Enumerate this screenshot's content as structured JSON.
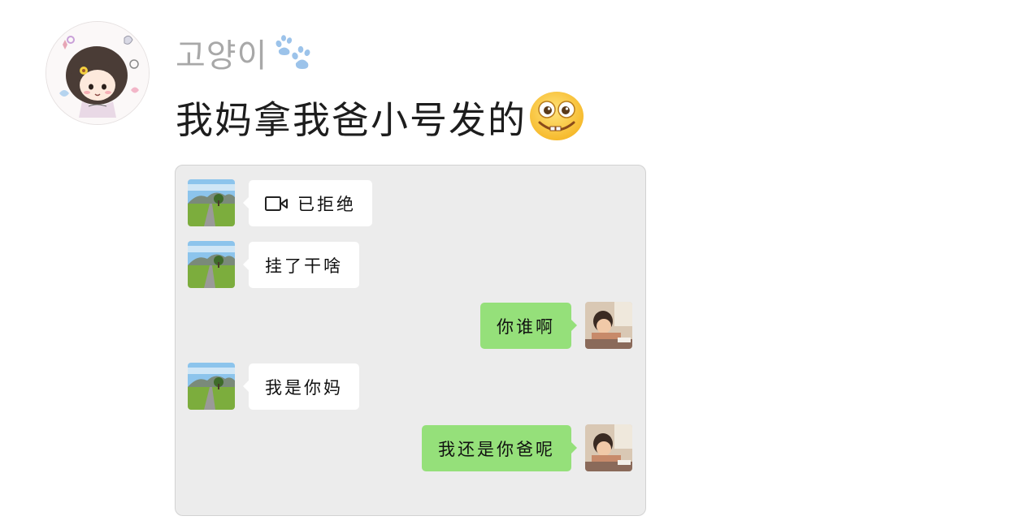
{
  "post": {
    "username": "고양이",
    "username_icon": "paw-print-icon",
    "text": "我妈拿我爸小号发的",
    "text_emoji": "grinning-emoji-icon"
  },
  "chat_screenshot": {
    "messages": [
      {
        "side": "left",
        "icon": "video-call-icon",
        "text": "已拒绝"
      },
      {
        "side": "left",
        "text": "挂了干啥"
      },
      {
        "side": "right",
        "text": "你谁啊"
      },
      {
        "side": "left",
        "text": "我是你妈"
      },
      {
        "side": "right",
        "text": "我还是你爸呢"
      }
    ]
  },
  "colors": {
    "username": "#a8a8a8",
    "post_text": "#1d1d1d",
    "chat_background": "#ececec",
    "bubble_incoming": "#ffffff",
    "bubble_outgoing": "#95e07a"
  }
}
